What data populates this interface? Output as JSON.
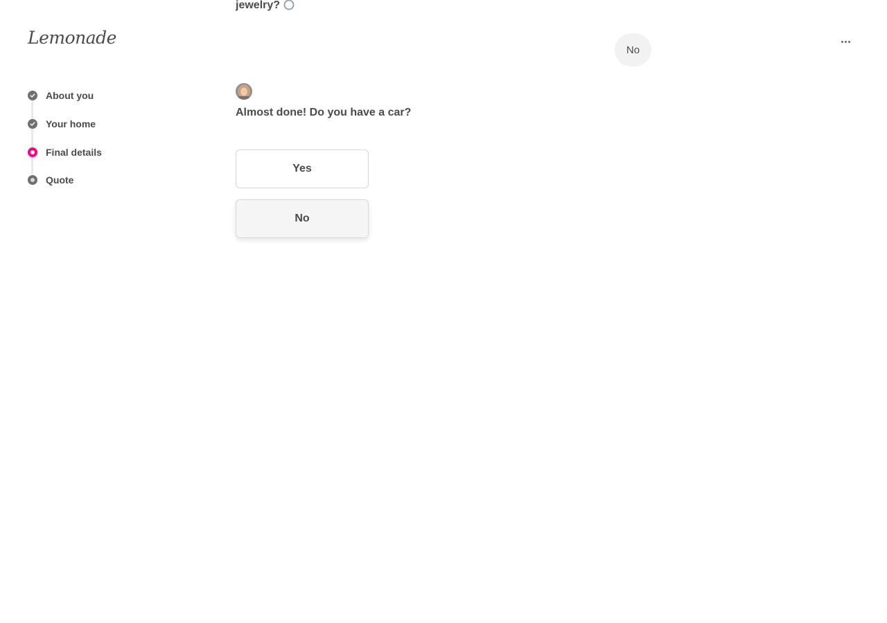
{
  "brand": {
    "logo_text": "Lemonade"
  },
  "sidebar": {
    "steps": [
      {
        "label": "About you",
        "state": "completed"
      },
      {
        "label": "Your home",
        "state": "completed"
      },
      {
        "label": "Final details",
        "state": "current"
      },
      {
        "label": "Quote",
        "state": "upcoming"
      }
    ]
  },
  "conversation": {
    "previous_question_tail": "jewelry?",
    "previous_question_emoji": "ring-icon",
    "user_answer": "No",
    "bot_question": "Almost done! Do you have a car?",
    "options": [
      {
        "label": "Yes"
      },
      {
        "label": "No"
      }
    ]
  },
  "header": {
    "more_menu_icon": "ellipsis-icon"
  },
  "colors": {
    "accent": "#ff0083",
    "text": "#4a4a4a",
    "step_done": "#6f6f6f",
    "bubble_bg": "#f2f2f2"
  }
}
